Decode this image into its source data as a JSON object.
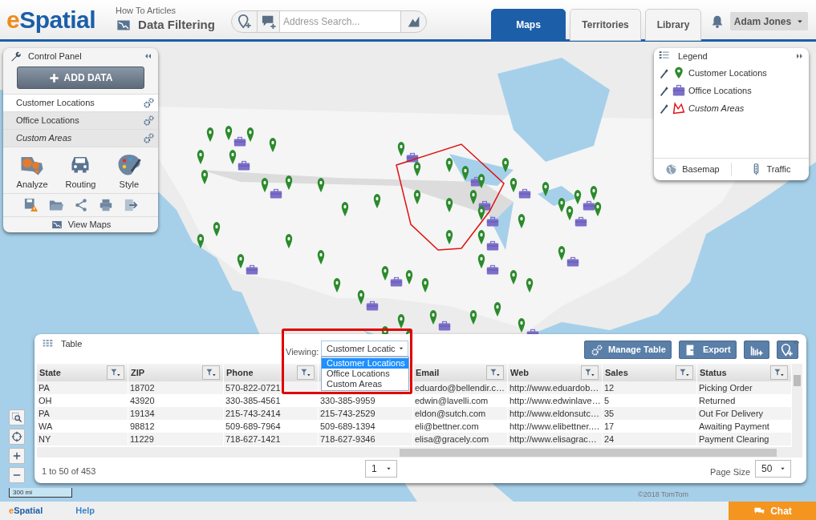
{
  "header": {
    "logo": "eSpatial",
    "breadcrumb": "How To Articles",
    "page_title": "Data Filtering",
    "search": {
      "placeholder": "Address Search..."
    },
    "tabs": [
      {
        "label": "Maps",
        "selected": true
      },
      {
        "label": "Territories",
        "selected": false
      },
      {
        "label": "Library",
        "selected": false
      }
    ],
    "user": "Adam Jones"
  },
  "control_panel": {
    "title": "Control Panel",
    "add_button": "ADD DATA",
    "layers": [
      {
        "label": "Customer Locations",
        "kind": "points",
        "selected": true
      },
      {
        "label": "Office Locations",
        "kind": "points",
        "selected": false
      },
      {
        "label": "Custom Areas",
        "kind": "area",
        "selected": false
      }
    ],
    "tools": [
      {
        "label": "Analyze",
        "kind": "analyze"
      },
      {
        "label": "Routing",
        "kind": "routing"
      },
      {
        "label": "Style",
        "kind": "style"
      }
    ],
    "view_maps": "View Maps"
  },
  "legend": {
    "title": "Legend",
    "items": [
      {
        "label": "Customer Locations",
        "kind": "pin"
      },
      {
        "label": "Office Locations",
        "kind": "briefcase"
      },
      {
        "label": "Custom Areas",
        "kind": "area"
      }
    ],
    "buttons": [
      {
        "label": "Basemap",
        "kind": "globe"
      },
      {
        "label": "Traffic",
        "kind": "traffic"
      }
    ]
  },
  "map": {
    "scale": "300 mi",
    "attribution": "©2018 TomTom"
  },
  "table": {
    "title": "Table",
    "viewing_label": "Viewing:",
    "viewing_value": "Customer Locatic",
    "options": [
      {
        "label": "Customer Locations",
        "selected": true
      },
      {
        "label": "Office Locations",
        "selected": false
      },
      {
        "label": "Custom Areas",
        "selected": false
      }
    ],
    "buttons": [
      {
        "label": "Manage Table",
        "kind": "gears"
      },
      {
        "label": "Export",
        "kind": "export"
      }
    ],
    "columns": [
      {
        "label": "State",
        "kind": "text"
      },
      {
        "label": "ZIP",
        "kind": "text"
      },
      {
        "label": "Phone",
        "kind": "text"
      },
      {
        "kind": "covered"
      },
      {
        "label": "Email",
        "kind": "text"
      },
      {
        "label": "Web",
        "kind": "text"
      },
      {
        "label": "Sales",
        "kind": "text"
      },
      {
        "label": "Status",
        "kind": "text"
      }
    ],
    "rows": [
      [
        "PA",
        "18702",
        "570-822-0721",
        "",
        "eduardo@bellendir.c…",
        "http://www.eduardob…",
        "12",
        "Picking Order"
      ],
      [
        "OH",
        "43920",
        "330-385-4561",
        "330-385-9959",
        "edwin@lavelli.com",
        "http://www.edwinlave…",
        "5",
        "Returned"
      ],
      [
        "PA",
        "19134",
        "215-743-2414",
        "215-743-2529",
        "eldon@sutch.com",
        "http://www.eldonsutc…",
        "35",
        "Out For Delivery"
      ],
      [
        "WA",
        "98812",
        "509-689-7964",
        "509-689-1394",
        "eli@bettner.com",
        "http://www.elibettner.…",
        "17",
        "Awaiting Payment"
      ],
      [
        "NY",
        "11229",
        "718-627-1421",
        "718-627-9346",
        "elisa@gracely.com",
        "http://www.elisagrac…",
        "24",
        "Payment Clearing"
      ]
    ],
    "range": "1 to 50 of 453",
    "page": "1",
    "page_size_label": "Page Size",
    "page_size": "50"
  },
  "footer": {
    "logo": "eSpatial",
    "help": "Help",
    "chat": "Chat"
  }
}
